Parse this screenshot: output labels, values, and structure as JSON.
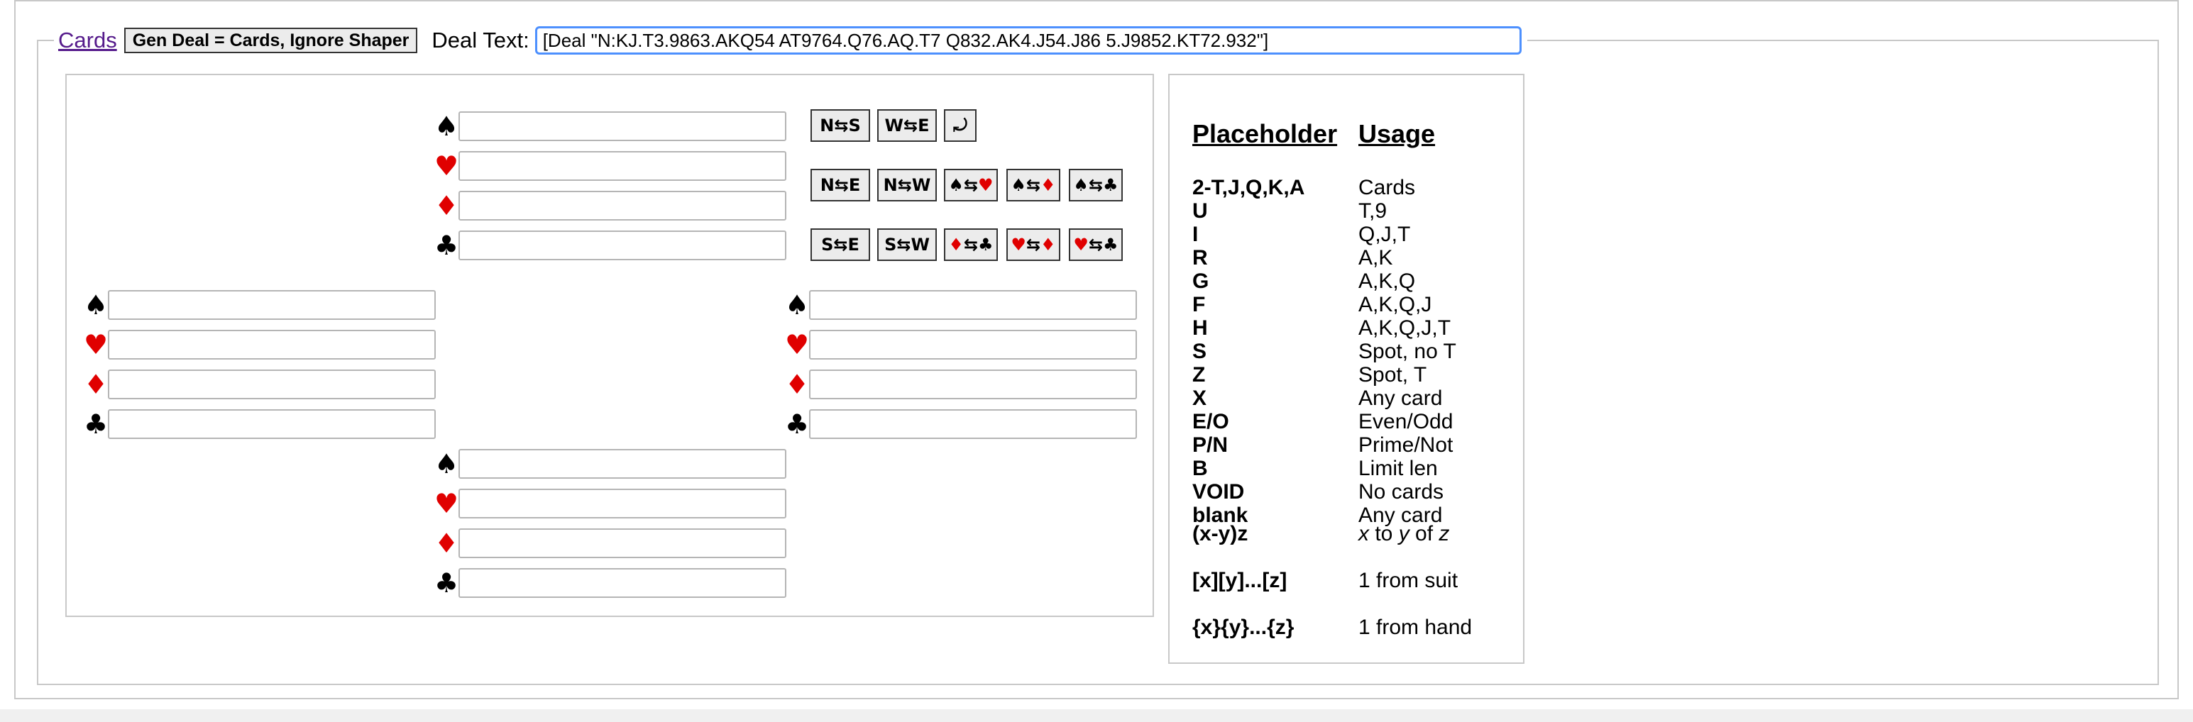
{
  "legend": {
    "cards_link": "Cards",
    "gen_button": "Gen Deal = Cards, Ignore Shaper",
    "deal_label": "Deal Text:",
    "deal_value": "[Deal \"N:KJ.T3.9863.AKQ54 AT9764.Q76.AQ.T7 Q832.AK4.J54.J86 5.J9852.KT72.932\"]"
  },
  "suits": [
    {
      "symbol": "♠",
      "color": "#000000"
    },
    {
      "symbol": "♥",
      "color": "#e00000"
    },
    {
      "symbol": "♦",
      "color": "#e00000"
    },
    {
      "symbol": "♣",
      "color": "#000000"
    }
  ],
  "swap_buttons": {
    "n_s": "N⇆S",
    "w_e": "W⇆E",
    "rotate": "⤾",
    "n_e": "N⇆E",
    "n_w": "N⇆W",
    "s_h_a": "♠",
    "s_h_b": "♥",
    "s_d_a": "♠",
    "s_d_b": "♦",
    "s_c_a": "♠",
    "s_c_b": "♣",
    "s_e": "S⇆E",
    "s_w": "S⇆W",
    "d_c_a": "♦",
    "d_c_b": "♣",
    "h_d_a": "♥",
    "h_d_b": "♦",
    "h_c_a": "♥",
    "h_c_b": "♣",
    "arrow": "⇆"
  },
  "placeholders": {
    "header_key": "Placeholder",
    "header_val": "Usage",
    "rows": [
      {
        "key": "2-T,J,Q,K,A",
        "val": "Cards"
      },
      {
        "key": "U",
        "val": "T,9"
      },
      {
        "key": "I",
        "val": "Q,J,T"
      },
      {
        "key": "R",
        "val": "A,K"
      },
      {
        "key": "G",
        "val": "A,K,Q"
      },
      {
        "key": "F",
        "val": "A,K,Q,J"
      },
      {
        "key": "H",
        "val": "A,K,Q,J,T"
      },
      {
        "key": "S",
        "val": "Spot, no T"
      },
      {
        "key": "Z",
        "val": "Spot, T"
      },
      {
        "key": "X",
        "val": "Any card"
      },
      {
        "key": "E/O",
        "val": "Even/Odd"
      },
      {
        "key": "P/N",
        "val": "Prime/Not"
      },
      {
        "key": "B",
        "val": "Limit len"
      },
      {
        "key": "VOID",
        "val": "No cards"
      },
      {
        "key": "blank",
        "val": "Any card"
      }
    ],
    "range_key": "(x-y)z",
    "range_x": "x",
    "range_to": " to ",
    "range_y": "y",
    "range_of": " of ",
    "range_z": "z",
    "suit_key": "[x][y]...[z]",
    "suit_val": "1 from suit",
    "hand_key": "{x}{y}...{z}",
    "hand_val": "1 from hand"
  }
}
